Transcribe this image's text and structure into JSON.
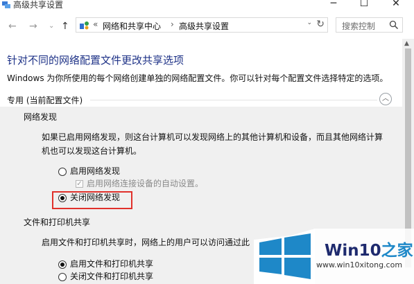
{
  "window": {
    "title": "高级共享设置"
  },
  "nav": {
    "back_label": "←",
    "forward_label": "→",
    "dropdown_label": "⌄",
    "up_label": "↑"
  },
  "address": {
    "overflow": "«",
    "segments": [
      "网络和共享中心",
      "高级共享设置"
    ],
    "separator": "›"
  },
  "search": {
    "placeholder": "搜索控制"
  },
  "content": {
    "heading": "针对不同的网络配置文件更改共享选项",
    "description": "Windows 为你所使用的每个网络创建单独的网络配置文件。你可以针对每个配置文件选择特定的选项。",
    "profile_section": "专用 (当前配置文件)",
    "network_discovery": {
      "title": "网络发现",
      "desc_line1": "如果已启用网络发现，则这台计算机可以发现网络上的其他计算机和设备，而且其他网络计算",
      "desc_line2": "机也可以发现这台计算机。",
      "on_label": "启用网络发现",
      "auto_setup_label": "启用网络连接设备的自动设置。",
      "off_label": "关闭网络发现",
      "selected": "off"
    },
    "file_printer_sharing": {
      "title": "文件和打印机共享",
      "desc": "启用文件和打印机共享时，网络上的用户可以访问通过此",
      "on_label": "启用文件和打印机共享",
      "off_label": "关闭文件和打印机共享",
      "selected": "on"
    }
  },
  "watermark": {
    "brand_main": "Win10",
    "brand_accent": "之家",
    "url": "www.win10xitong.com"
  },
  "colors": {
    "heading": "#1e3287",
    "highlight": "#e0302a",
    "panel_bg": "#f0f0f0",
    "logo_blue": "#1e88c8"
  }
}
